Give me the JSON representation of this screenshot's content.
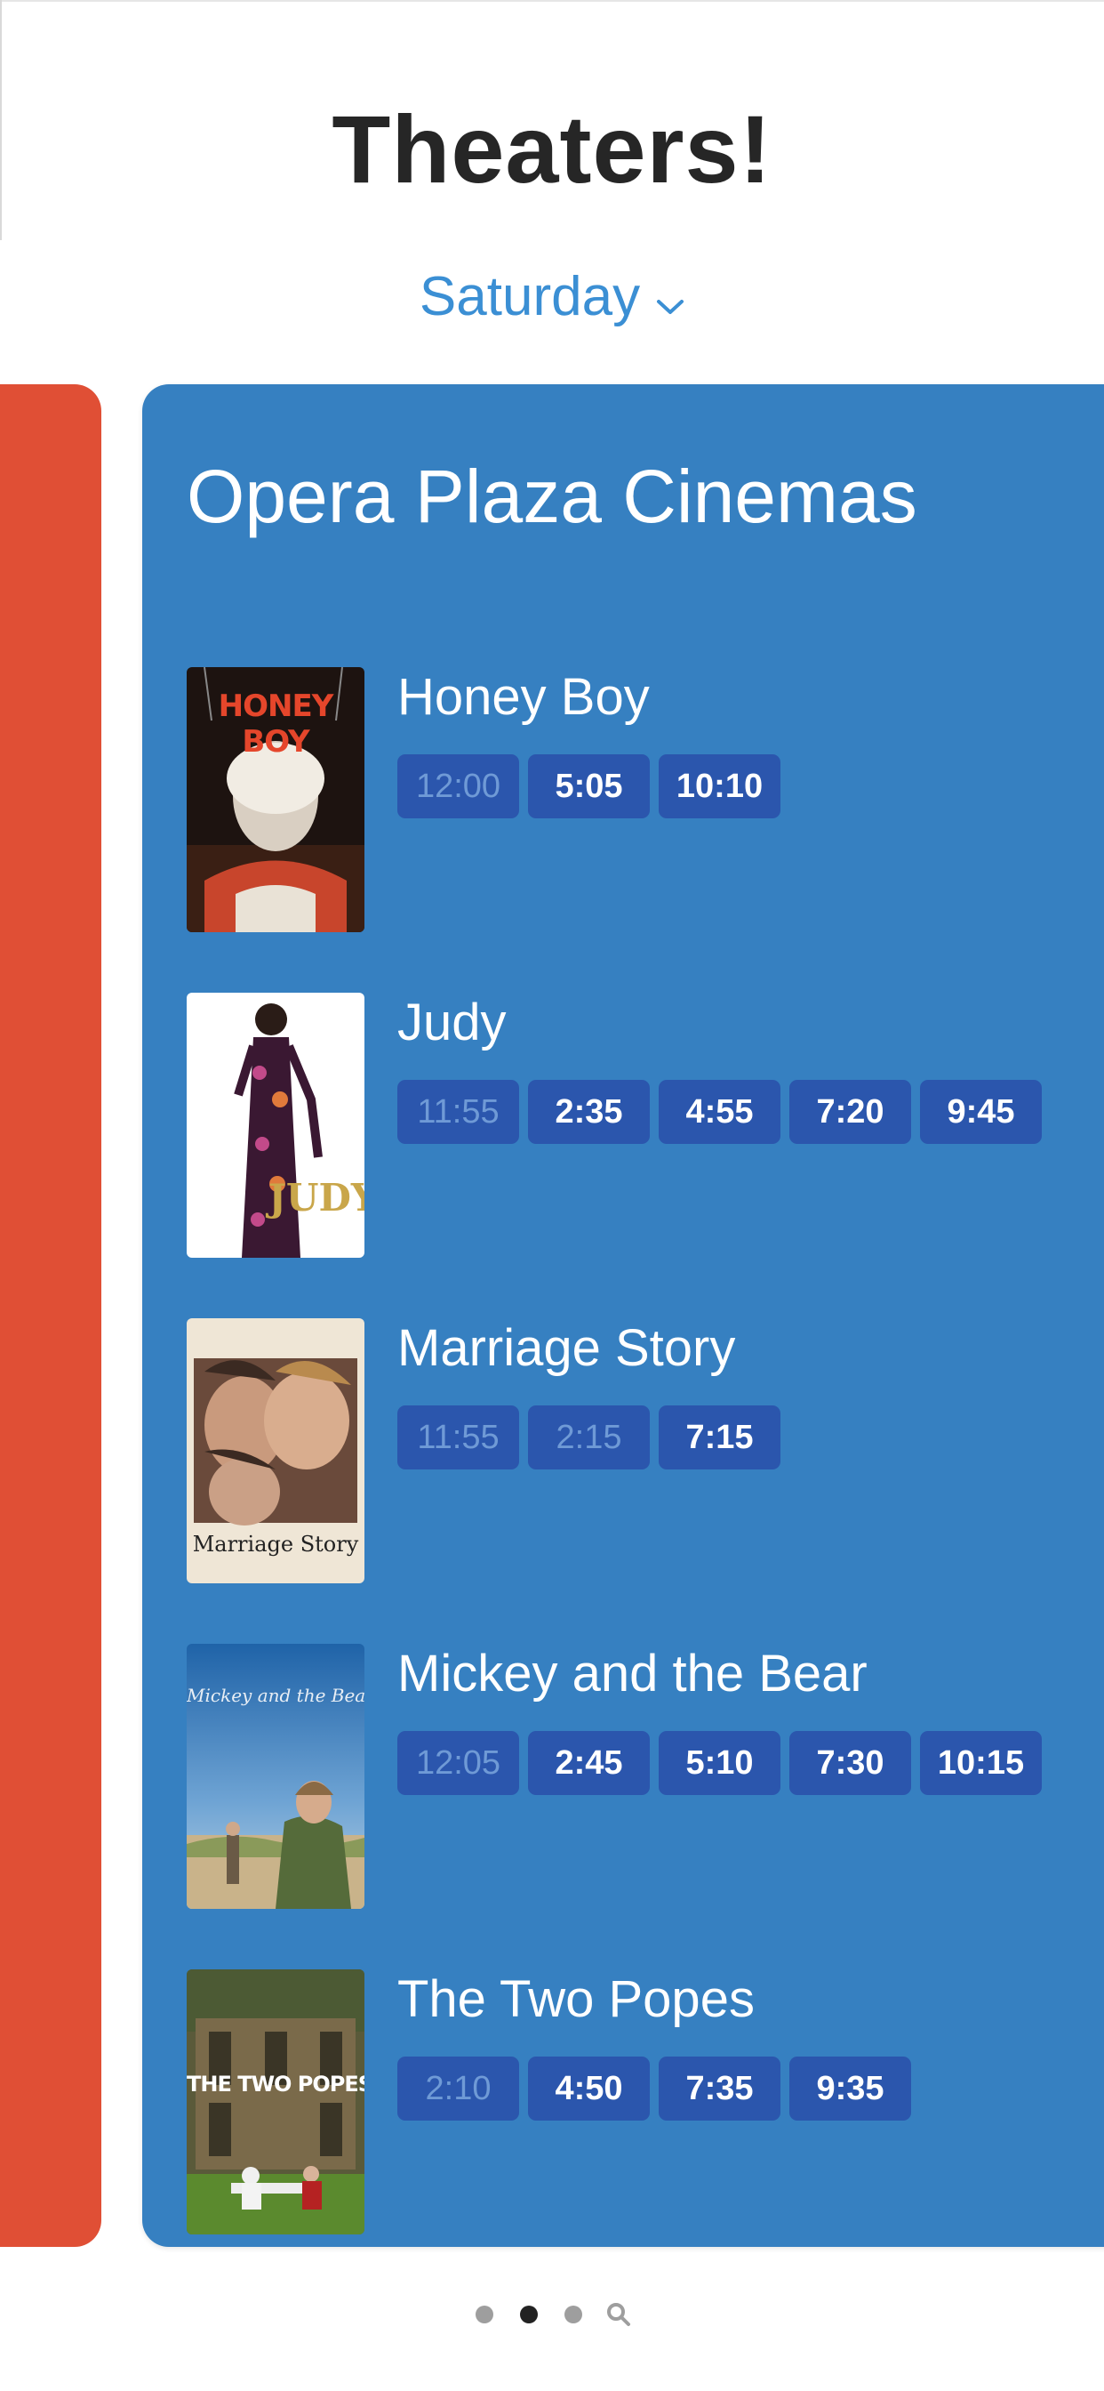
{
  "header": {
    "title": "Theaters!",
    "day": "Saturday"
  },
  "theater": {
    "name": "Opera Plaza Cinemas",
    "movies": [
      {
        "title": "Honey Boy",
        "poster_text": "HONEY BOY",
        "times": [
          {
            "label": "12:00",
            "past": true
          },
          {
            "label": "5:05",
            "past": false
          },
          {
            "label": "10:10",
            "past": false
          }
        ]
      },
      {
        "title": "Judy",
        "poster_text": "JUDY",
        "times": [
          {
            "label": "11:55",
            "past": true
          },
          {
            "label": "2:35",
            "past": false
          },
          {
            "label": "4:55",
            "past": false
          },
          {
            "label": "7:20",
            "past": false
          },
          {
            "label": "9:45",
            "past": false
          }
        ]
      },
      {
        "title": "Marriage Story",
        "poster_text": "Marriage Story",
        "times": [
          {
            "label": "11:55",
            "past": true
          },
          {
            "label": "2:15",
            "past": true
          },
          {
            "label": "7:15",
            "past": false
          }
        ]
      },
      {
        "title": "Mickey and the Bear",
        "poster_text": "Mickey and the Bear",
        "times": [
          {
            "label": "12:05",
            "past": true
          },
          {
            "label": "2:45",
            "past": false
          },
          {
            "label": "5:10",
            "past": false
          },
          {
            "label": "7:30",
            "past": false
          },
          {
            "label": "10:15",
            "past": false
          }
        ]
      },
      {
        "title": "The Two Popes",
        "poster_text": "THE TWO POPES",
        "times": [
          {
            "label": "2:10",
            "past": true
          },
          {
            "label": "4:50",
            "past": false
          },
          {
            "label": "7:35",
            "past": false
          },
          {
            "label": "9:35",
            "past": false
          }
        ]
      }
    ]
  },
  "pager": {
    "page_count": 3,
    "active_index": 1,
    "has_search": true
  },
  "colors": {
    "accent": "#3b8fd4",
    "card_blue": "#3680c1",
    "card_red": "#e04f35",
    "time_button": "#2b56ad",
    "time_past_text": "#6f9ad6"
  },
  "icons": {
    "day_dropdown": "chevron-down-icon",
    "pager_search": "search-icon"
  }
}
